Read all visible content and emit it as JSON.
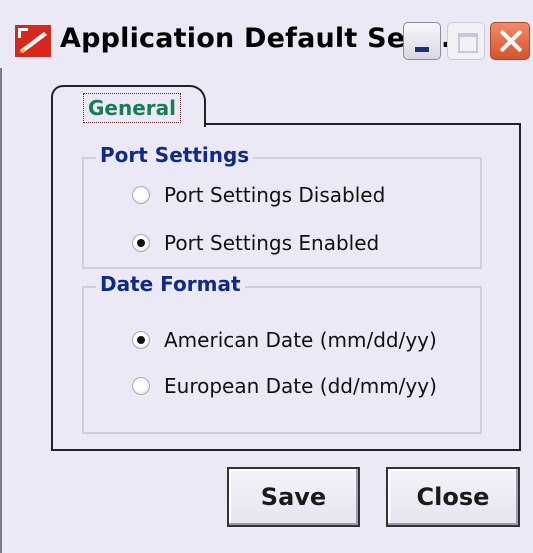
{
  "window": {
    "title": "Application Default Setti...",
    "colors": {
      "background": "#ece9f6",
      "accent": "#102a8a",
      "tab_label": "#1a7a5c",
      "close_button": "#d9532a"
    }
  },
  "titlebar": {
    "icons": [
      "app-icon",
      "minimize-icon",
      "maximize-icon",
      "close-icon"
    ]
  },
  "tabs": [
    {
      "label": "General",
      "selected": true
    }
  ],
  "port_settings": {
    "title": "Port Settings",
    "options": [
      {
        "label": "Port Settings Disabled",
        "checked": false
      },
      {
        "label": "Port Settings Enabled",
        "checked": true
      }
    ]
  },
  "date_format": {
    "title": "Date Format",
    "options": [
      {
        "label": "American Date (mm/dd/yy)",
        "checked": true
      },
      {
        "label": "European Date (dd/mm/yy)",
        "checked": false
      }
    ]
  },
  "buttons": {
    "save_label": "Save",
    "close_label": "Close"
  }
}
